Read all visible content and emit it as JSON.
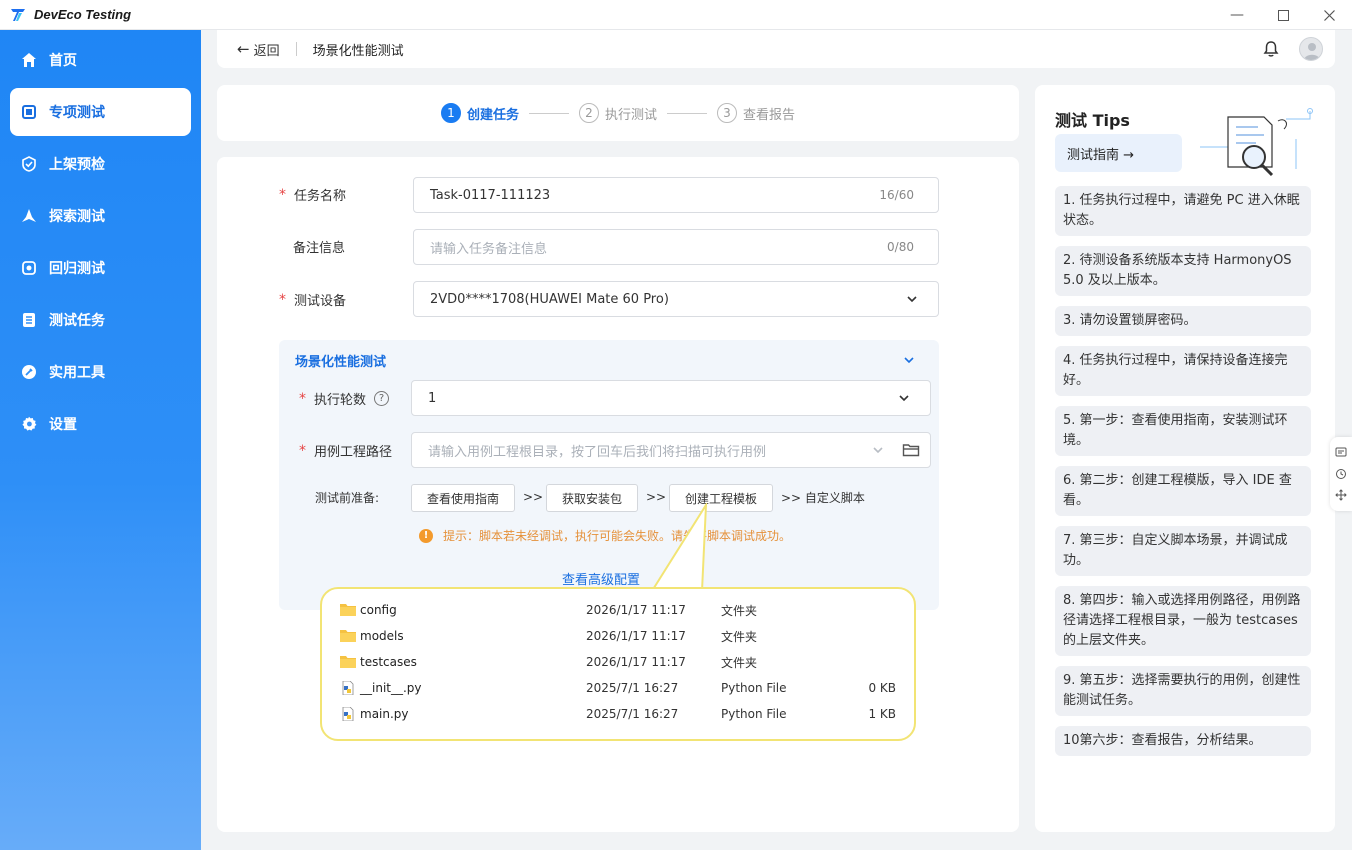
{
  "app": {
    "title": "DevEco Testing"
  },
  "sidebar": {
    "items": [
      {
        "label": "首页",
        "icon": "home-icon"
      },
      {
        "label": "专项测试",
        "icon": "square-icon",
        "active": true
      },
      {
        "label": "上架预检",
        "icon": "shield-check-icon"
      },
      {
        "label": "探索测试",
        "icon": "explore-icon"
      },
      {
        "label": "回归测试",
        "icon": "regression-icon"
      },
      {
        "label": "测试任务",
        "icon": "list-icon"
      },
      {
        "label": "实用工具",
        "icon": "tool-icon"
      },
      {
        "label": "设置",
        "icon": "gear-icon"
      }
    ]
  },
  "header": {
    "back_label": "返回",
    "title": "场景化性能测试"
  },
  "steps": [
    {
      "num": "1",
      "label": "创建任务",
      "active": true
    },
    {
      "num": "2",
      "label": "执行测试"
    },
    {
      "num": "3",
      "label": "查看报告"
    }
  ],
  "form": {
    "task_name": {
      "label": "任务名称",
      "value": "Task-0117-111123",
      "counter": "16/60"
    },
    "remark": {
      "label": "备注信息",
      "placeholder": "请输入任务备注信息",
      "counter": "0/80"
    },
    "device": {
      "label": "测试设备",
      "value": "2VD0****1708(HUAWEI Mate 60 Pro)"
    },
    "section": {
      "title": "场景化性能测试",
      "rounds": {
        "label": "执行轮数",
        "value": "1"
      },
      "case_path": {
        "label": "用例工程路径",
        "placeholder": "请输入用例工程根目录，按了回车后我们将扫描可执行用例"
      },
      "prep": {
        "label": "测试前准备:",
        "btn_guide": "查看使用指南",
        "btn_package": "获取安装包",
        "btn_template": "创建工程模板",
        "arrow": ">>",
        "custom": ">> 自定义脚本"
      },
      "warning": "提示：脚本若未经调试，执行可能会失败。请先将脚本调试成功。",
      "advanced": "查看高级配置"
    }
  },
  "files": [
    {
      "name": "config",
      "date": "2026/1/17 11:17",
      "type": "文件夹",
      "size": "",
      "kind": "folder"
    },
    {
      "name": "models",
      "date": "2026/1/17 11:17",
      "type": "文件夹",
      "size": "",
      "kind": "folder"
    },
    {
      "name": "testcases",
      "date": "2026/1/17 11:17",
      "type": "文件夹",
      "size": "",
      "kind": "folder"
    },
    {
      "name": "__init__.py",
      "date": "2025/7/1 16:27",
      "type": "Python File",
      "size": "0 KB",
      "kind": "python"
    },
    {
      "name": "main.py",
      "date": "2025/7/1 16:27",
      "type": "Python File",
      "size": "1 KB",
      "kind": "python"
    }
  ],
  "tips": {
    "title": "测试 Tips",
    "guide_label": "测试指南 →",
    "items": [
      "1. 任务执行过程中，请避免 PC 进入休眠状态。",
      "2. 待测设备系统版本支持 HarmonyOS 5.0 及以上版本。",
      "3. 请勿设置锁屏密码。",
      "4. 任务执行过程中，请保持设备连接完好。",
      "5. 第一步：查看使用指南，安装测试环境。",
      "6. 第二步：创建工程模版，导入 IDE 查看。",
      "7. 第三步：自定义脚本场景，并调试成功。",
      "8. 第四步：输入或选择用例路径，用例路径请选择工程根目录，一般为 testcases 的上层文件夹。",
      "9. 第五步：选择需要执行的用例，创建性能测试任务。",
      "10第六步：查看报告，分析结果。"
    ]
  },
  "colors": {
    "accent": "#1a7cf2",
    "warning": "#e5913a",
    "required": "#e64545",
    "highlight": "#f2e474"
  }
}
